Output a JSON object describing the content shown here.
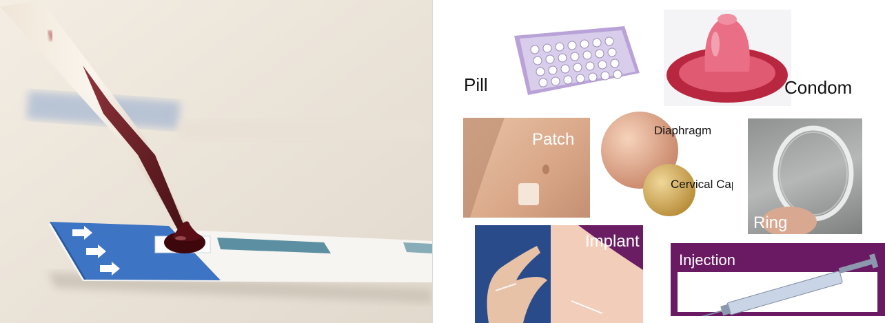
{
  "labels": {
    "pill": "Pill",
    "condom": "Condom",
    "patch": "Patch",
    "diaphragm": "Diaphragm",
    "cervical_cap": "Cervical Cap",
    "ring": "Ring",
    "implant": "Implant",
    "injection": "Injection"
  },
  "colors": {
    "test_strip_blue": "#3d74c4",
    "blood": "#5a0f16",
    "condom_red": "#c8384e",
    "implant_purple": "#6b1d64",
    "injection_purple": "#6a1a63",
    "pill_pack_purple": "#b9a2d8"
  }
}
